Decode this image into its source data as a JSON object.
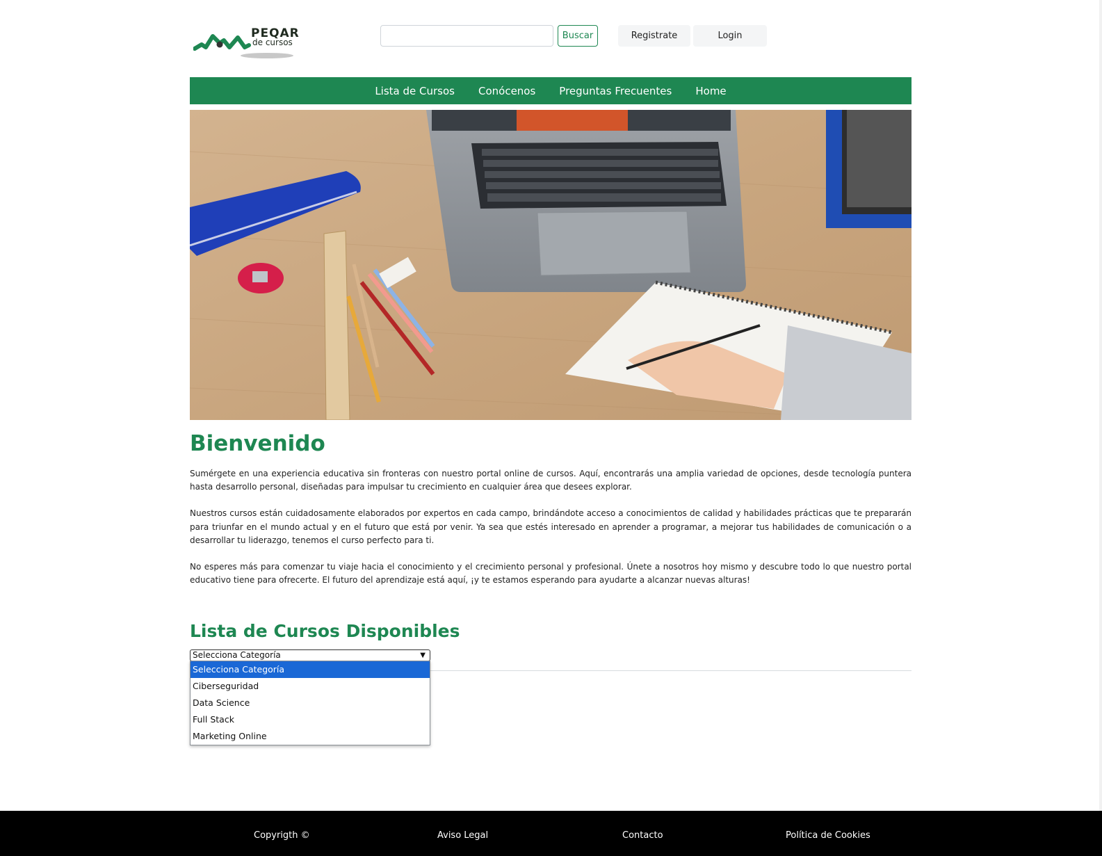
{
  "header": {
    "logo": {
      "line1": "PEQAR",
      "line2": "de cursos"
    },
    "search": {
      "placeholder": "",
      "value": "",
      "button_label": "Buscar"
    },
    "register_label": "Registrate",
    "login_label": "Login"
  },
  "nav": {
    "items": [
      {
        "label": "Lista de Cursos"
      },
      {
        "label": "Conócenos"
      },
      {
        "label": "Preguntas Frecuentes"
      },
      {
        "label": "Home"
      }
    ]
  },
  "hero": {
    "next_icon": "chevron-right-icon"
  },
  "welcome": {
    "title": "Bienvenido",
    "paragraphs": [
      "Sumérgete en una experiencia educativa sin fronteras con nuestro portal online de cursos. Aquí, encontrarás una amplia variedad de opciones, desde tecnología puntera hasta desarrollo personal, diseñadas para impulsar tu crecimiento en cualquier área que desees explorar.",
      "Nuestros cursos están cuidadosamente elaborados por expertos en cada campo, brindándote acceso a conocimientos de calidad y habilidades prácticas que te prepararán para triunfar en el mundo actual y en el futuro que está por venir. Ya sea que estés interesado en aprender a programar, a mejorar tus habilidades de comunicación o a desarrollar tu liderazgo, tenemos el curso perfecto para ti.",
      "No esperes más para comenzar tu viaje hacia el conocimiento y el crecimiento personal y profesional. Únete a nosotros hoy mismo y descubre todo lo que nuestro portal educativo tiene para ofrecerte. El futuro del aprendizaje está aquí, ¡y te estamos esperando para ayudarte a alcanzar nuevas alturas!"
    ]
  },
  "courses": {
    "title": "Lista de Cursos Disponibles",
    "select_value": "Selecciona Categoría",
    "options": [
      {
        "label": "Selecciona Categoría"
      },
      {
        "label": "Ciberseguridad"
      },
      {
        "label": "Data Science"
      },
      {
        "label": "Full Stack"
      },
      {
        "label": "Marketing Online"
      }
    ]
  },
  "footer": {
    "copyright": "Copyrigth ©",
    "legal": "Aviso Legal",
    "contact": "Contacto",
    "cookies": "Política de Cookies"
  },
  "colors": {
    "brand": "#1e8752",
    "footer": "#000000",
    "selected_option": "#1a68d6"
  }
}
